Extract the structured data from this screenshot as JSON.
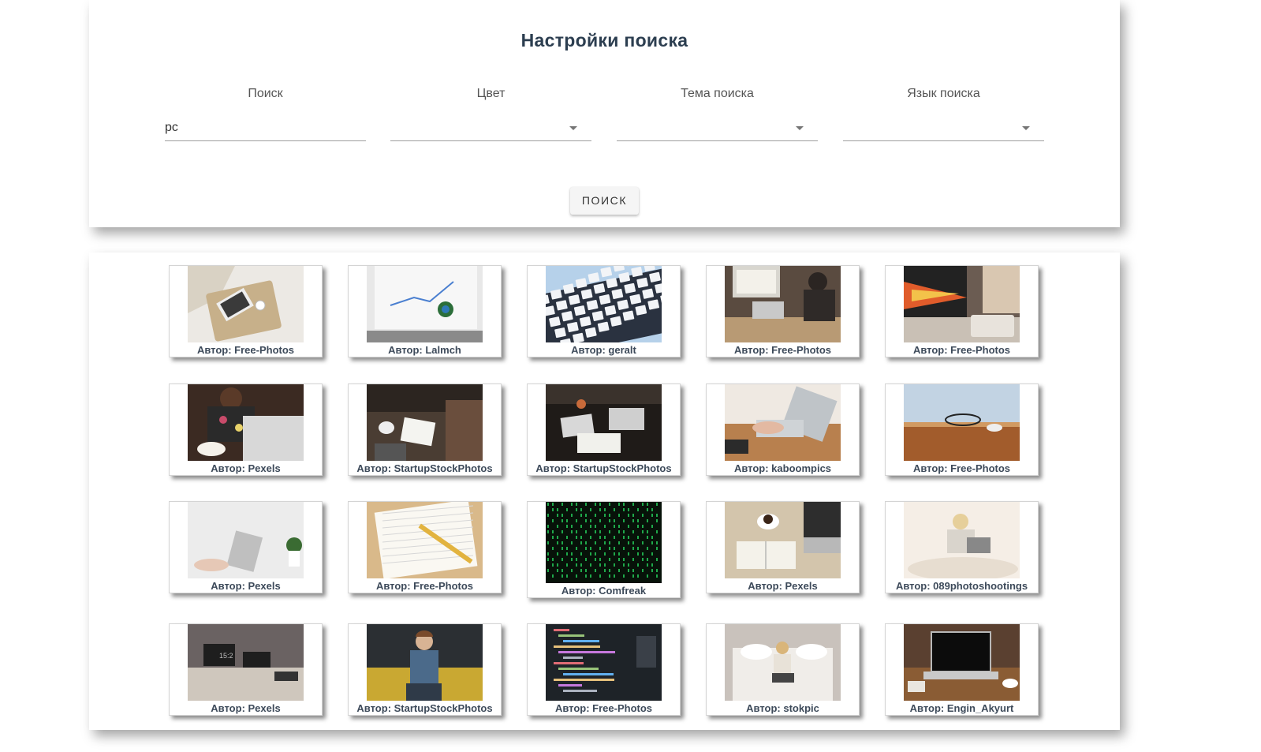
{
  "settings": {
    "title": "Настройки поиска",
    "fields": {
      "search": {
        "label": "Поиск",
        "value": "pc"
      },
      "color": {
        "label": "Цвет",
        "value": ""
      },
      "topic": {
        "label": "Тема поиска",
        "value": ""
      },
      "language": {
        "label": "Язык поиска",
        "value": ""
      }
    },
    "search_button": "ПОИСК"
  },
  "results": [
    {
      "caption": "Автор: Free-Photos",
      "image": "laptop-on-tray"
    },
    {
      "caption": "Автор: Lalmch",
      "image": "laptop-with-chart"
    },
    {
      "caption": "Автор: geralt",
      "image": "keyboard-closeup"
    },
    {
      "caption": "Автор: Free-Photos",
      "image": "man-at-laptop-desk"
    },
    {
      "caption": "Автор: Free-Photos",
      "image": "laptop-with-tablet"
    },
    {
      "caption": "Автор: Pexels",
      "image": "woman-with-laptop-coffee"
    },
    {
      "caption": "Автор: StartupStockPhotos",
      "image": "team-meeting-table"
    },
    {
      "caption": "Автор: StartupStockPhotos",
      "image": "meeting-table-laptops"
    },
    {
      "caption": "Автор: kaboompics",
      "image": "hands-typing-laptop"
    },
    {
      "caption": "Автор: Free-Photos",
      "image": "glasses-on-desk"
    },
    {
      "caption": "Автор: Pexels",
      "image": "typing-white-desk"
    },
    {
      "caption": "Автор: Free-Photos",
      "image": "notebook-and-pencil"
    },
    {
      "caption": "Автор: Comfreak",
      "image": "green-code-matrix"
    },
    {
      "caption": "Автор: Pexels",
      "image": "coffee-notebook-laptop"
    },
    {
      "caption": "Автор: 089photoshootings",
      "image": "woman-on-bed-laptop"
    },
    {
      "caption": "Автор: Pexels",
      "image": "desk-with-monitors"
    },
    {
      "caption": "Автор: StartupStockPhotos",
      "image": "man-on-yellow-sofa"
    },
    {
      "caption": "Автор: Free-Photos",
      "image": "code-on-screen"
    },
    {
      "caption": "Автор: stokpic",
      "image": "woman-on-bed-overhead"
    },
    {
      "caption": "Автор: Engin_Akyurt",
      "image": "laptop-on-wooden-table"
    }
  ],
  "colors": {
    "title": "#2c3e50",
    "caption": "#3d4a5a",
    "button_bg": "#f5f5f5"
  }
}
